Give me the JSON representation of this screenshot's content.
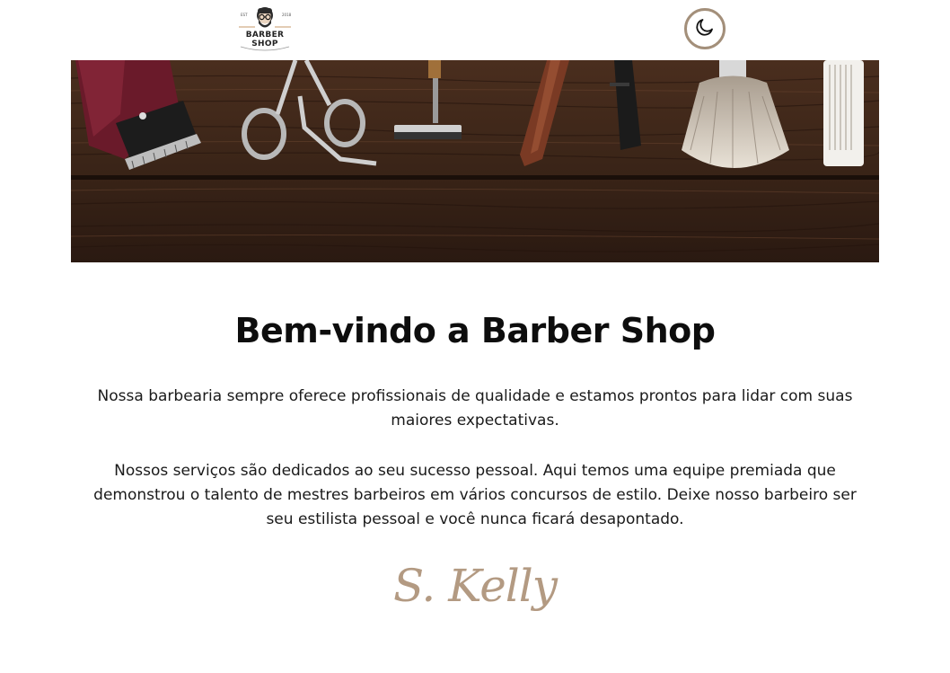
{
  "header": {
    "logo": {
      "text": "BARBER SHOP",
      "since_left": "EST",
      "since_right": "2018"
    },
    "theme_toggle_icon": "moon-icon"
  },
  "hero": {
    "image_desc_icon": "barber-tools-image"
  },
  "main": {
    "title": "Bem-vindo a Barber Shop",
    "paragraph_1": "Nossa barbearia sempre oferece profissionais de qualidade e estamos prontos para lidar com suas maiores expectativas.",
    "paragraph_2": "Nossos serviços são dedicados ao seu sucesso pessoal. Aqui temos uma equipe premiada que demonstrou o talento de mestres barbeiros em vários concursos de estilo. Deixe nosso barbeiro ser seu estilista pessoal e você nunca ficará desapontado.",
    "signature": "S. Kelly"
  },
  "colors": {
    "accent": "#a38f7a",
    "signature": "#b39a82",
    "wood_dark": "#3a2418",
    "wood_mid": "#5a3a26"
  }
}
